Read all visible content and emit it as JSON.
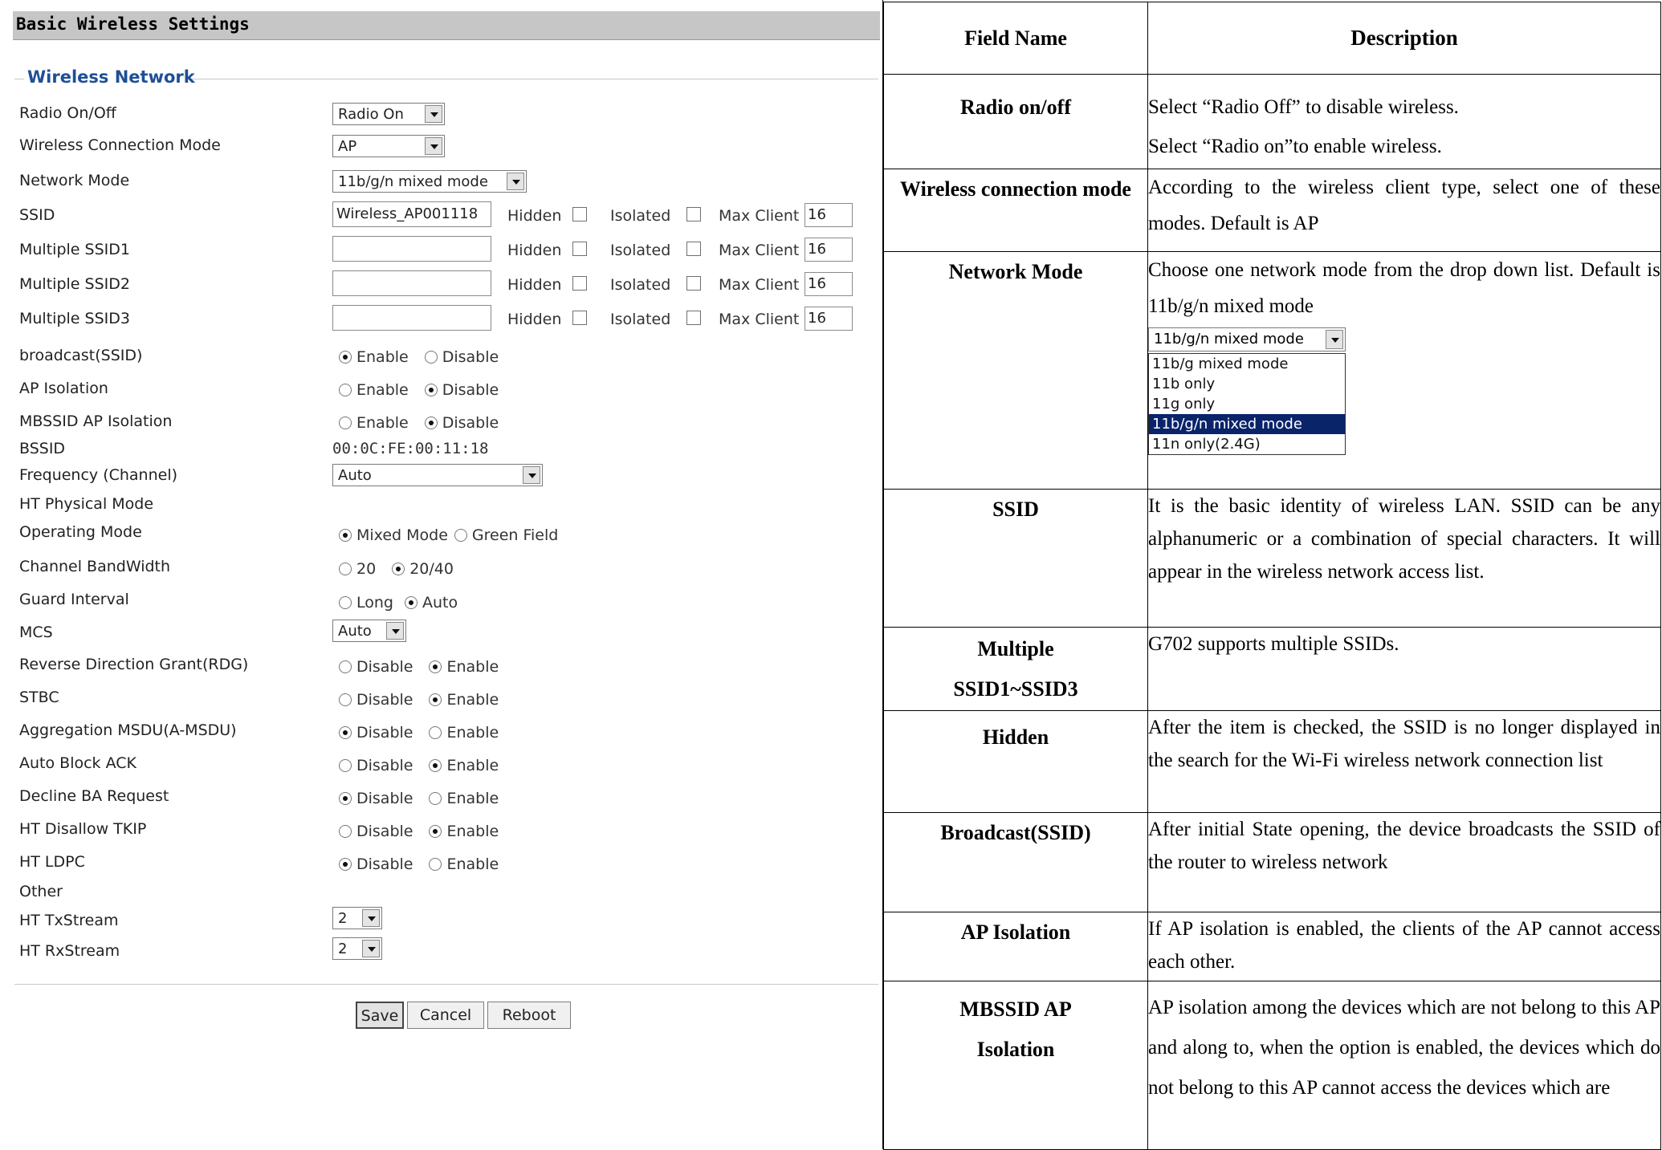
{
  "left": {
    "title": "Basic Wireless Settings",
    "legend": "Wireless Network",
    "radio": {
      "label": "Radio On/Off",
      "value": "Radio On"
    },
    "conn_mode": {
      "label": "Wireless Connection Mode",
      "value": "AP"
    },
    "net_mode": {
      "label": "Network Mode",
      "value": "11b/g/n mixed mode"
    },
    "ssid_common": {
      "hidden": "Hidden",
      "isolated": "Isolated",
      "max_client": "Max Client"
    },
    "ssids": [
      {
        "label": "SSID",
        "value": "Wireless_AP001118",
        "max": "16"
      },
      {
        "label": "Multiple SSID1",
        "value": "",
        "max": "16"
      },
      {
        "label": "Multiple SSID2",
        "value": "",
        "max": "16"
      },
      {
        "label": "Multiple SSID3",
        "value": "",
        "max": "16"
      }
    ],
    "broadcast": {
      "label": "broadcast(SSID)",
      "opt1": "Enable",
      "opt2": "Disable",
      "selected": 1
    },
    "ap_isolation": {
      "label": "AP Isolation",
      "opt1": "Enable",
      "opt2": "Disable",
      "selected": 2
    },
    "mbssid": {
      "label": "MBSSID AP Isolation",
      "opt1": "Enable",
      "opt2": "Disable",
      "selected": 2
    },
    "bssid": {
      "label": "BSSID",
      "value": "00:0C:FE:00:11:18"
    },
    "frequency": {
      "label": "Frequency (Channel)",
      "value": "Auto"
    },
    "ht_phys": {
      "label": "HT Physical Mode"
    },
    "op_mode": {
      "label": "Operating Mode",
      "opt1": "Mixed Mode",
      "opt2": "Green Field",
      "selected": 1
    },
    "bandwidth": {
      "label": "Channel BandWidth",
      "opt1": "20",
      "opt2": "20/40",
      "selected": 2
    },
    "guard": {
      "label": "Guard Interval",
      "opt1": "Long",
      "opt2": "Auto",
      "selected": 2
    },
    "mcs": {
      "label": "MCS",
      "value": "Auto"
    },
    "rdg": {
      "label": "Reverse Direction Grant(RDG)",
      "opt1": "Disable",
      "opt2": "Enable",
      "selected": 2
    },
    "stbc": {
      "label": "STBC",
      "opt1": "Disable",
      "opt2": "Enable",
      "selected": 2
    },
    "amsdu": {
      "label": "Aggregation MSDU(A-MSDU)",
      "opt1": "Disable",
      "opt2": "Enable",
      "selected": 1
    },
    "autoblock": {
      "label": "Auto Block ACK",
      "opt1": "Disable",
      "opt2": "Enable",
      "selected": 2
    },
    "declineba": {
      "label": "Decline BA Request",
      "opt1": "Disable",
      "opt2": "Enable",
      "selected": 1
    },
    "tkip": {
      "label": "HT Disallow TKIP",
      "opt1": "Disable",
      "opt2": "Enable",
      "selected": 2
    },
    "ldpc": {
      "label": "HT LDPC",
      "opt1": "Disable",
      "opt2": "Enable",
      "selected": 1
    },
    "other": {
      "label": "Other"
    },
    "txstream": {
      "label": "HT TxStream",
      "value": "2"
    },
    "rxstream": {
      "label": "HT RxStream",
      "value": "2"
    },
    "buttons": {
      "save": "Save",
      "cancel": "Cancel",
      "reboot": "Reboot"
    }
  },
  "table": {
    "header": {
      "field": "Field Name",
      "desc": "Description"
    },
    "rows": [
      {
        "field": "Radio on/off",
        "desc_lines": [
          "Select “Radio Off” to disable wireless.",
          "Select “Radio on”to enable wireless."
        ]
      },
      {
        "field": "Wireless connection mode",
        "desc": "According to the wireless client type, select one of these modes. Default is AP"
      },
      {
        "field": "Network Mode",
        "desc": "Choose one network mode from the drop down list. Default is 11b/g/n mixed mode"
      },
      {
        "field": "SSID",
        "desc": "It is the basic identity of wireless LAN. SSID can be any alphanumeric or a combination of special characters. It will appear in the wireless network access list."
      },
      {
        "field": "Multiple SSID1~SSID3",
        "desc": "G702 supports multiple SSIDs."
      },
      {
        "field": "Hidden",
        "desc": "After the item is checked, the SSID is no longer displayed in the search for the Wi-Fi wireless network connection list"
      },
      {
        "field": "Broadcast(SSID)",
        "desc": "After initial State opening, the device broadcasts the SSID of the router to wireless network"
      },
      {
        "field": "AP Isolation",
        "desc": "If AP isolation is enabled, the clients of the AP cannot access each other."
      },
      {
        "field": "MBSSID AP Isolation",
        "desc": "AP isolation among the devices which are not belong to this AP and along to, when the option is enabled, the devices which do not belong to this AP cannot access the devices which are"
      }
    ],
    "dropdown_demo": {
      "selected": "11b/g/n mixed mode",
      "options": [
        "11b/g mixed mode",
        "11b only",
        "11g only",
        "11b/g/n mixed mode",
        "11n only(2.4G)"
      ],
      "highlighted_index": 3
    }
  }
}
